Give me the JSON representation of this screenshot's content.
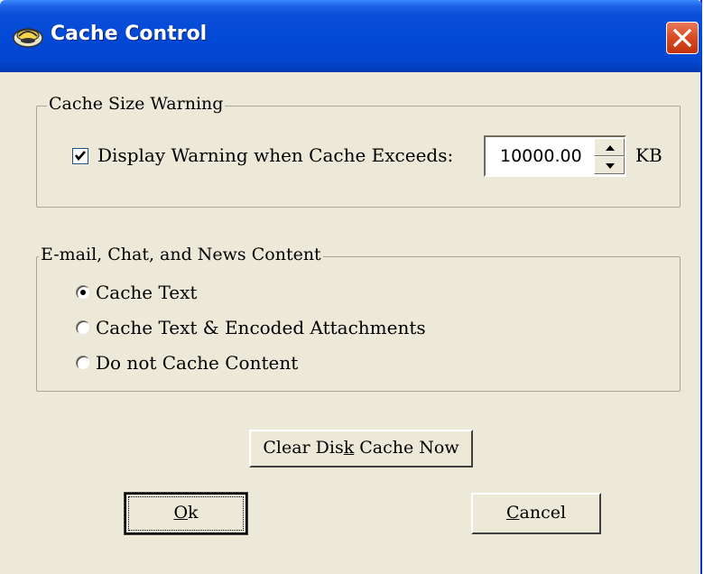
{
  "window": {
    "title": "Cache Control",
    "app_icon": "cache-app-icon",
    "close_icon": "close-icon"
  },
  "cache_size_warning": {
    "group_label": "Cache Size Warning",
    "checkbox_label": "Display Warning when Cache Exceeds:",
    "checked": true,
    "threshold_value": "10000.00",
    "unit": "KB"
  },
  "content_cache": {
    "group_label": "E-mail, Chat, and News Content",
    "options": [
      {
        "label": "Cache Text",
        "selected": true
      },
      {
        "label": "Cache Text & Encoded Attachments",
        "selected": false
      },
      {
        "label": "Do not Cache Content",
        "selected": false
      }
    ]
  },
  "buttons": {
    "clear_cache": {
      "pre": "Clear Dis",
      "accel": "k",
      "post": " Cache Now"
    },
    "ok": {
      "pre": "",
      "accel": "O",
      "post": "k"
    },
    "cancel": {
      "pre": "",
      "accel": "C",
      "post": "ancel"
    }
  },
  "colors": {
    "dialog_bg": "#ece9d8",
    "titlebar_blue": "#0249d6",
    "close_red": "#d84a20"
  }
}
